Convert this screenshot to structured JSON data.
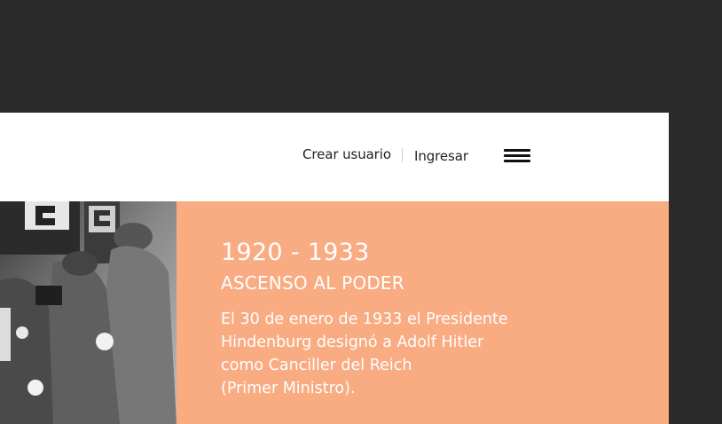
{
  "header": {
    "links": [
      {
        "label": "Crear usuario"
      },
      {
        "label": "Ingresar"
      }
    ]
  },
  "hero": {
    "image_alt": "historical black-and-white photo",
    "years": "1920 - 1933",
    "subtitle": "ASCENSO AL PODER",
    "description_lines": [
      "El 30 de enero de 1933 el Presidente",
      "Hindenburg designó a Adolf Hitler",
      "como Canciller del Reich",
      "(Primer Ministro)."
    ]
  },
  "colors": {
    "background": "#2a2a2a",
    "panel": "#f9ab82",
    "header": "#ffffff",
    "text_on_panel": "#ffffff"
  }
}
